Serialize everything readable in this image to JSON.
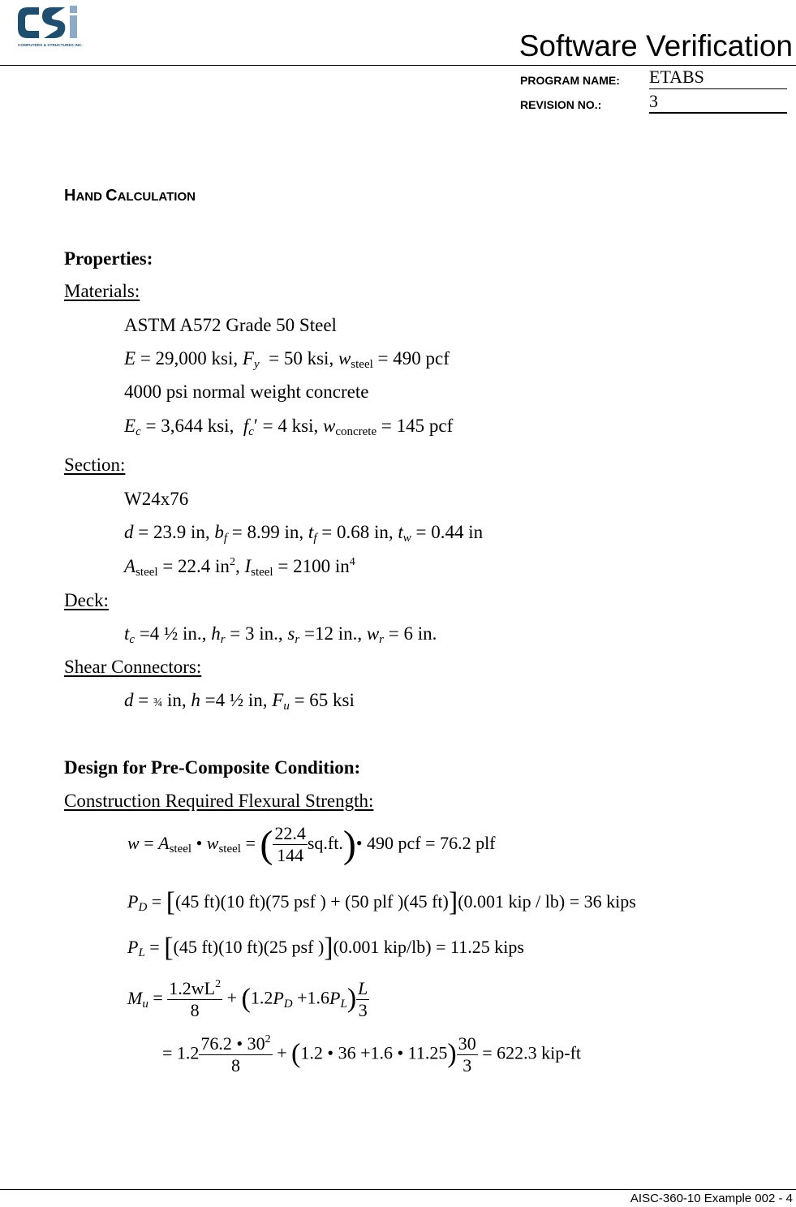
{
  "header": {
    "logo_text": "CSI",
    "logo_subtitle": "COMPUTERS & STRUCTURES INC.",
    "title": "Software Verification",
    "program_name_label": "PROGRAM NAME:",
    "program_name_value": "ETABS",
    "revision_label": "REVISION NO.:",
    "revision_value": "3",
    "colors": {
      "logo_dark": "#1f4e6e",
      "logo_light": "#8faac6"
    }
  },
  "section_heading": {
    "first_big_H": "H",
    "rest_1": "AND ",
    "big_C": "C",
    "rest_2": "ALCULATION"
  },
  "properties": {
    "heading": "Properties:",
    "materials": {
      "label": "Materials:",
      "steel_grade": "ASTM A572 Grade 50 Steel",
      "E": "29,000 ksi",
      "Fy": "50 ksi",
      "w_steel": "490 pcf",
      "concrete_desc": "4000 psi normal weight concrete",
      "Ec": "3,644 ksi",
      "fc": "4 ksi",
      "w_concrete": "145 pcf"
    },
    "section": {
      "label": "Section:",
      "shape": "W24x76",
      "d": "23.9 in",
      "bf": "8.99 in",
      "tf": "0.68 in",
      "tw": "0.44 in",
      "A_steel": "22.4 in",
      "I_steel": "2100 in"
    },
    "deck": {
      "label": "Deck:",
      "tc": "4 ½  in.",
      "hr": "3 in.",
      "sr": "12 in.",
      "wr": "6 in."
    },
    "shear_connectors": {
      "label": "Shear Connectors:",
      "d": "¾",
      "h": "4 ½ in",
      "Fu": "65 ksi"
    }
  },
  "design": {
    "heading": "Design for Pre-Composite Condition:",
    "subheading": "Construction Required Flexural Strength:",
    "eq_w": {
      "frac_num": "22.4",
      "frac_den": "144",
      "unit": "sq.ft.",
      "factor": "490 pcf",
      "result": "76.2 plf"
    },
    "eq_PD": {
      "body": "(45 ft)(10 ft)(75 psf ) + (50 plf )(45 ft)",
      "conv": "(0.001 kip / lb)",
      "result": "36 kips"
    },
    "eq_PL": {
      "body": "(45 ft)(10 ft)(25 psf )",
      "conv": "(0.001 kip/lb)",
      "result": "11.25 kips"
    },
    "eq_Mu": {
      "num1": "1.2wL",
      "den1": "8",
      "coef_D": "1.2",
      "coef_L": "1.6",
      "num2": "L",
      "den2": "3",
      "sub_line": {
        "lead": "1.2",
        "num": "76.2  • 30",
        "den": "8",
        "paren": "1.2 • 36 +1.6 • 11.25",
        "num2": "30",
        "den2": "3",
        "result": "622.3 kip-ft"
      }
    }
  },
  "footer": {
    "text": "AISC-360-10 Example 002 - 4"
  }
}
